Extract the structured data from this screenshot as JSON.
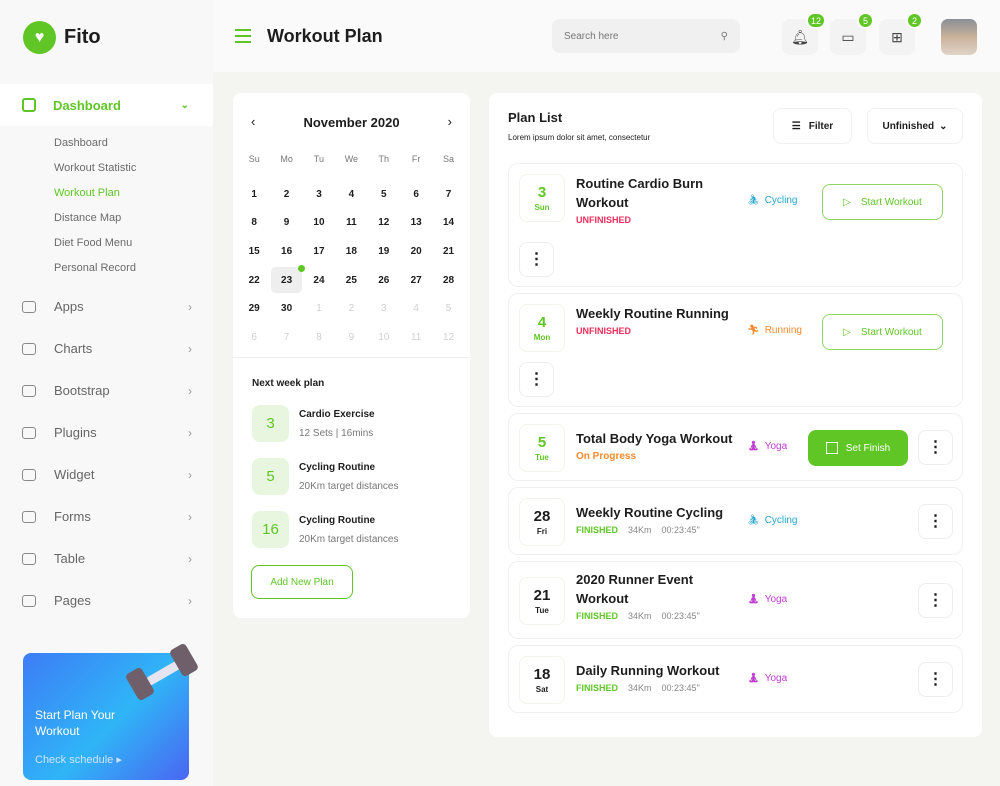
{
  "brand": {
    "name": "Fito",
    "accent": "#5fc625"
  },
  "sidebar": {
    "active": {
      "label": "Dashboard",
      "icon": "dashboard-icon"
    },
    "submenu": [
      "Dashboard",
      "Workout Statistic",
      "Workout Plan",
      "Distance Map",
      "Diet Food Menu",
      "Personal Record"
    ],
    "submenu_active": "Workout Plan",
    "items": [
      {
        "label": "Apps",
        "icon": "monitor-icon"
      },
      {
        "label": "Charts",
        "icon": "sliders-icon"
      },
      {
        "label": "Bootstrap",
        "icon": "globe-icon"
      },
      {
        "label": "Plugins",
        "icon": "heart-icon"
      },
      {
        "label": "Widget",
        "icon": "gear-icon"
      },
      {
        "label": "Forms",
        "icon": "form-icon"
      },
      {
        "label": "Table",
        "icon": "table-icon"
      },
      {
        "label": "Pages",
        "icon": "layers-icon"
      }
    ],
    "promo": {
      "title": "Start Plan Your Workout",
      "link": "Check schedule"
    }
  },
  "header": {
    "title": "Workout Plan",
    "search_placeholder": "Search here",
    "notifications": "12",
    "messages": "5",
    "gifts": "2"
  },
  "calendar": {
    "month": "November 2020",
    "weekdays": [
      "Su",
      "Mo",
      "Tu",
      "We",
      "Th",
      "Fr",
      "Sa"
    ],
    "selected": "23",
    "next_month_days": [
      "1",
      "2",
      "3",
      "4",
      "5",
      "6",
      "7",
      "8",
      "9",
      "10",
      "11",
      "12"
    ]
  },
  "next_week": {
    "title": "Next week plan",
    "items": [
      {
        "n": "3",
        "name": "Cardio Exercise",
        "detail": "12 Sets | 16mins"
      },
      {
        "n": "5",
        "name": "Cycling Routine",
        "detail": "20Km target distances"
      },
      {
        "n": "16",
        "name": "Cycling Routine",
        "detail": "20Km target distances"
      }
    ],
    "add_label": "Add New Plan"
  },
  "plan_list": {
    "title": "Plan List",
    "subtitle": "Lorem ipsum dolor sit amet, consectetur",
    "filter_label": "Filter",
    "status_select": "Unfinished",
    "start_label": "Start Workout",
    "finish_label": "Set Finish",
    "rows": [
      {
        "day": "3",
        "weekday": "Sun",
        "name": "Routine Cardio Burn Workout",
        "status": "UNFINISHED",
        "type": "Cycling"
      },
      {
        "day": "4",
        "weekday": "Mon",
        "name": "Weekly Routine Running",
        "status": "UNFINISHED",
        "type": "Running"
      },
      {
        "day": "5",
        "weekday": "Tue",
        "name": "Total Body Yoga Workout",
        "status": "On Progress",
        "type": "Yoga"
      },
      {
        "day": "28",
        "weekday": "Fri",
        "name": "Weekly Routine Cycling",
        "status": "FINISHED",
        "distance": "34Km",
        "time": "00:23:45\"",
        "type": "Cycling"
      },
      {
        "day": "21",
        "weekday": "Tue",
        "name": "2020 Runner Event Workout",
        "status": "FINISHED",
        "distance": "34Km",
        "time": "00:23:45\"",
        "type": "Yoga"
      },
      {
        "day": "18",
        "weekday": "Sat",
        "name": "Daily Running Workout",
        "status": "FINISHED",
        "distance": "34Km",
        "time": "00:23:45\"",
        "type": "Yoga"
      }
    ]
  }
}
